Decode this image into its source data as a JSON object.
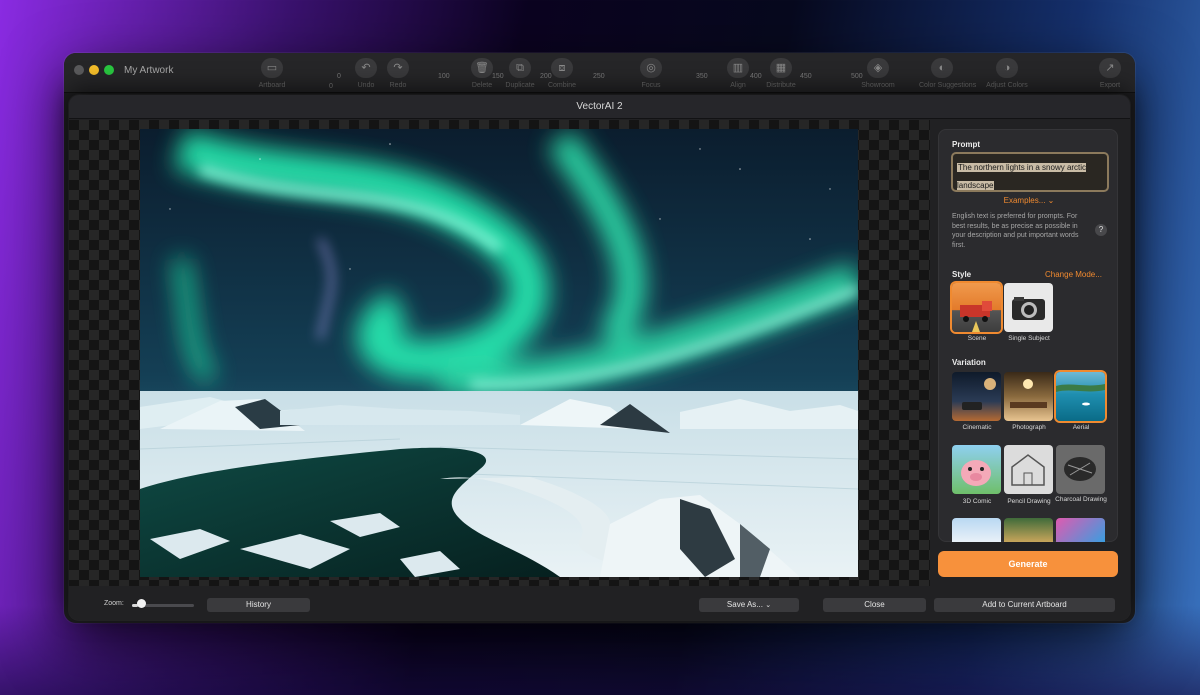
{
  "app": {
    "window_title": "My Artwork",
    "toolbar": [
      {
        "label": "Artboard",
        "icon": "artboard-icon"
      },
      {
        "label": "Undo",
        "icon": "undo-icon"
      },
      {
        "label": "Redo",
        "icon": "redo-icon"
      },
      {
        "label": "Delete",
        "icon": "trash-icon"
      },
      {
        "label": "Duplicate",
        "icon": "duplicate-icon"
      },
      {
        "label": "Combine",
        "icon": "combine-icon"
      },
      {
        "label": "Focus",
        "icon": "focus-icon"
      },
      {
        "label": "Align",
        "icon": "align-icon"
      },
      {
        "label": "Distribute",
        "icon": "distribute-icon"
      },
      {
        "label": "Showroom",
        "icon": "cube-icon"
      },
      {
        "label": "Color Suggestions",
        "icon": "palette-icon"
      },
      {
        "label": "Adjust Colors",
        "icon": "adjust-colors-icon"
      },
      {
        "label": "Export",
        "icon": "export-icon"
      }
    ],
    "ruler_ticks": [
      "0",
      "0",
      "100",
      "150",
      "200",
      "250",
      "300",
      "350",
      "400",
      "450",
      "500"
    ]
  },
  "dialog": {
    "title": "VectorAI 2",
    "image_icon": "aurora-arctic-image",
    "prompt": {
      "heading": "Prompt",
      "value": "The northern lights in a snowy arctic landscape",
      "examples_label": "Examples...",
      "help_text": "English text is preferred for prompts. For best results, be as precise as possible in your description and put important words first.",
      "help_icon": "?"
    },
    "style": {
      "heading": "Style",
      "change_mode_label": "Change Mode...",
      "options": [
        {
          "label": "Scene",
          "selected": true
        },
        {
          "label": "Single Subject",
          "selected": false
        }
      ]
    },
    "variation": {
      "heading": "Variation",
      "options": [
        {
          "label": "Cinematic",
          "selected": false
        },
        {
          "label": "Photograph",
          "selected": false
        },
        {
          "label": "Aerial",
          "selected": true
        },
        {
          "label": "3D Comic",
          "selected": false
        },
        {
          "label": "Pencil Drawing",
          "selected": false
        },
        {
          "label": "Charcoal Drawing",
          "selected": false
        }
      ]
    },
    "generate_label": "Generate",
    "bottom": {
      "zoom_label": "Zoom:",
      "zoom_level": 0.05,
      "history_label": "History",
      "save_as_label": "Save As...",
      "close_label": "Close",
      "add_label": "Add to Current Artboard"
    }
  },
  "colors": {
    "accent": "#f7913c",
    "panel": "#2b2b2e",
    "window": "#1c1c1e"
  }
}
